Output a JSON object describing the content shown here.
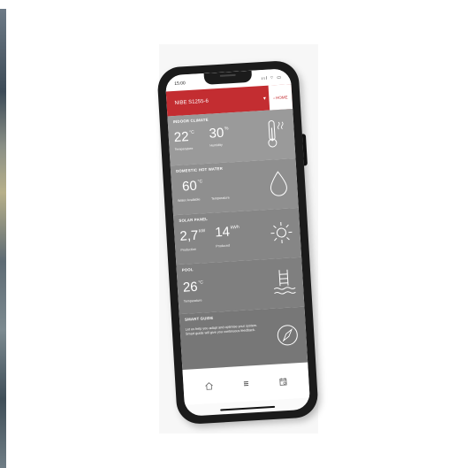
{
  "status_bar": {
    "time": "15:00",
    "icons": "ııl ⌔ ▭"
  },
  "header": {
    "device_name": "NIBE S1255-6",
    "chevron": "▾",
    "home_label": "‹ HOME"
  },
  "sections": {
    "indoor_climate": {
      "title": "INDOOR CLIMATE",
      "temp_value": "22",
      "temp_unit": "°C",
      "temp_caption": "Temperature",
      "humidity_value": "30",
      "humidity_unit": "%",
      "humidity_caption": "Humidity",
      "icon": "thermometer-icon"
    },
    "domestic_hot_water": {
      "title": "DOMESTIC HOT WATER",
      "temp_value": "60",
      "temp_unit": "°C",
      "caption_1": "Water Available",
      "caption_2": "Temperature",
      "icon": "water-drop-icon"
    },
    "solar_panel": {
      "title": "SOLAR PANEL",
      "production_value": "2,7",
      "production_unit": "kW",
      "production_caption": "Production",
      "produced_value": "14",
      "produced_unit": "kWh",
      "produced_caption": "Produced",
      "icon": "sun-icon"
    },
    "pool": {
      "title": "POOL",
      "temp_value": "26",
      "temp_unit": "°C",
      "temp_caption": "Temperature",
      "icon": "pool-ladder-icon"
    },
    "smart_guide": {
      "title": "SMART GUIDE",
      "text": "Let us help you adapt and optimise your system. Smart guide will give you continuous feedback.",
      "icon": "compass-icon"
    }
  },
  "bottom_nav": [
    {
      "icon": "home-icon"
    },
    {
      "icon": "menu-icon"
    },
    {
      "icon": "calendar-icon"
    }
  ],
  "colors": {
    "brand_red": "#c32d31"
  }
}
